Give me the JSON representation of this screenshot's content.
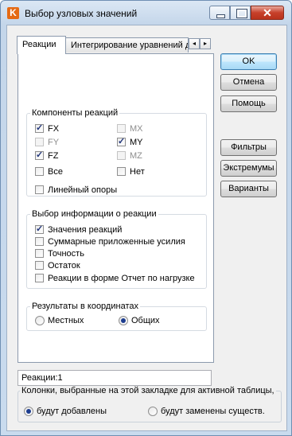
{
  "window": {
    "title": "Выбор узловых значений",
    "app_icon_letter": "K",
    "close_glyph": "✕"
  },
  "tabs": [
    {
      "label": "Реакции",
      "active": true
    },
    {
      "label": "Интегрирование уравнений д",
      "active": false
    }
  ],
  "tab_scroll": {
    "left": "◂",
    "right": "▸"
  },
  "components": {
    "legend": "Компоненты реакций",
    "items": [
      {
        "label": "FX",
        "checked": true,
        "disabled": false
      },
      {
        "label": "MX",
        "checked": false,
        "disabled": true
      },
      {
        "label": "FY",
        "checked": false,
        "disabled": true
      },
      {
        "label": "MY",
        "checked": true,
        "disabled": false
      },
      {
        "label": "FZ",
        "checked": true,
        "disabled": false
      },
      {
        "label": "MZ",
        "checked": false,
        "disabled": true
      },
      {
        "label": "Все",
        "checked": false,
        "disabled": false
      },
      {
        "label": "Нет",
        "checked": false,
        "disabled": false
      }
    ],
    "linear_supports": {
      "label": "Линейный опоры",
      "checked": false
    }
  },
  "info": {
    "legend": "Выбор информации о реакции",
    "items": [
      {
        "label": "Значения реакций",
        "checked": true
      },
      {
        "label": "Суммарные приложенные усилия",
        "checked": false
      },
      {
        "label": "Точность",
        "checked": false
      },
      {
        "label": "Остаток",
        "checked": false
      },
      {
        "label": "Реакции в форме Отчет по нагрузке",
        "checked": false
      }
    ]
  },
  "coords": {
    "legend": "Результаты в координатах",
    "options": [
      {
        "label": "Местных",
        "checked": false
      },
      {
        "label": "Общих",
        "checked": true
      }
    ]
  },
  "buttons": {
    "ok": "OK",
    "cancel": "Отмена",
    "help": "Помощь",
    "filters": "Фильтры",
    "extremes": "Экстремумы",
    "variants": "Варианты"
  },
  "status_field": "Реакции:1",
  "columns": {
    "legend": "Колонки, выбранные на этой закладке для активной таблицы,",
    "options": [
      {
        "label": "будут добавлены",
        "checked": true
      },
      {
        "label": "будут заменены существ.",
        "checked": false
      }
    ]
  }
}
